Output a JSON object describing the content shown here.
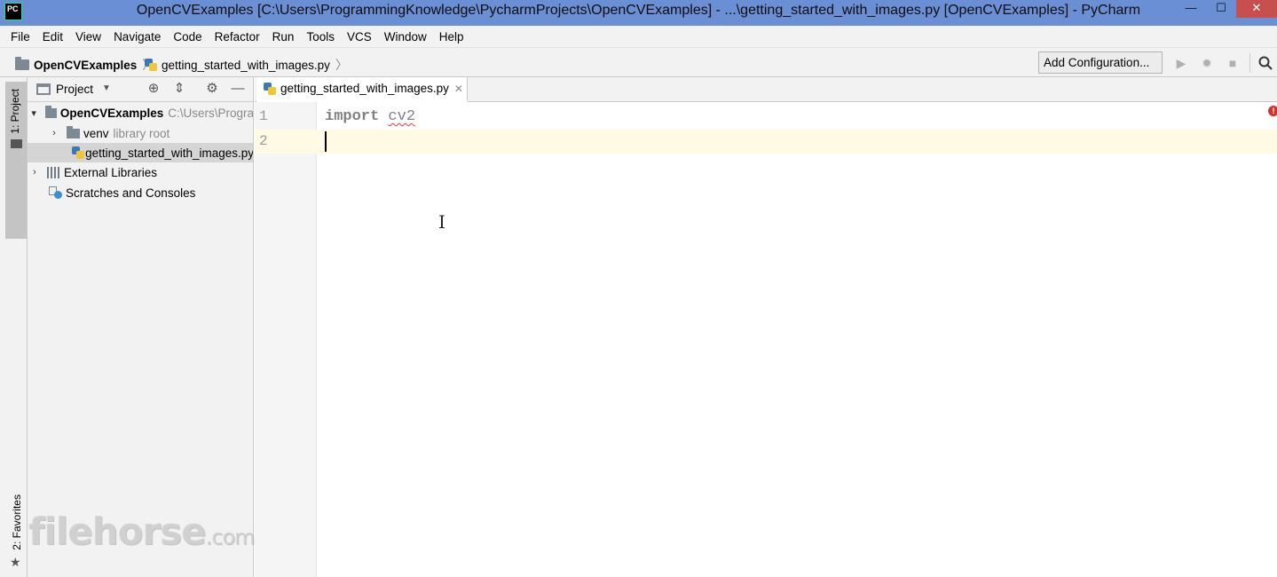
{
  "window": {
    "app_icon": "PC",
    "title": "OpenCVExamples [C:\\Users\\ProgrammingKnowledge\\PycharmProjects\\OpenCVExamples] - ...\\getting_started_with_images.py [OpenCVExamples] - PyCharm",
    "controls": {
      "minimize": "—",
      "maximize": "☐",
      "close": "✕"
    }
  },
  "menu": {
    "items": [
      "File",
      "Edit",
      "View",
      "Navigate",
      "Code",
      "Refactor",
      "Run",
      "Tools",
      "VCS",
      "Window",
      "Help"
    ]
  },
  "navbar": {
    "project": "OpenCVExamples",
    "file": "getting_started_with_images.py",
    "add_config": "Add Configuration..."
  },
  "toolstrip": {
    "project_tab": "1: Project",
    "favorites_tab": "2: Favorites"
  },
  "project_panel": {
    "title": "Project",
    "tree": [
      {
        "label": "OpenCVExamples",
        "hint": "C:\\Users\\Progra"
      },
      {
        "label": "venv",
        "hint": "library root"
      },
      {
        "label": "getting_started_with_images.py"
      },
      {
        "label": "External Libraries"
      },
      {
        "label": "Scratches and Consoles"
      }
    ]
  },
  "editor": {
    "tab_label": "getting_started_with_images.py",
    "line_numbers": [
      "1",
      "2"
    ],
    "code": {
      "keyword": "import",
      "module": "cv2"
    },
    "error_marker": "!"
  },
  "watermark": {
    "text": "filehorse",
    "suffix": ".com"
  }
}
